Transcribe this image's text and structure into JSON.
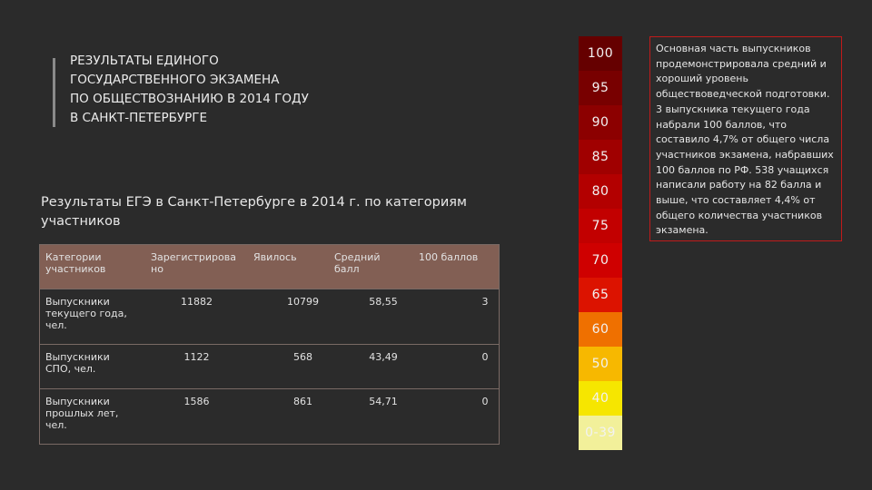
{
  "slide": {
    "title_lines": [
      "РЕЗУЛЬТАТЫ ЕДИНОГО",
      "ГОСУДАРСТВЕННОГО ЭКЗАМЕНА",
      "ПО ОБЩЕСТВОЗНАНИЮ В 2014 ГОДУ",
      "В САНКТ-ПЕТЕРБУРГЕ"
    ],
    "subtitle": "Результаты ЕГЭ в Санкт-Петербурге в 2014 г. по категориям участников"
  },
  "table": {
    "headers": [
      "Категории участников",
      "Зарегистрирова но",
      "Явилось",
      "Средний балл",
      "100 баллов"
    ],
    "rows": [
      {
        "category": "Выпускники текущего года, чел.",
        "registered": "11882",
        "appeared": "10799",
        "average": "58,55",
        "hundred": "3"
      },
      {
        "category": "Выпускники СПО, чел.",
        "registered": "1122",
        "appeared": "568",
        "average": "43,49",
        "hundred": "0"
      },
      {
        "category": "Выпускники прошлых лет, чел.",
        "registered": "1586",
        "appeared": "861",
        "average": "54,71",
        "hundred": "0"
      }
    ]
  },
  "scale": {
    "items": [
      {
        "label": "100",
        "color": "#650000"
      },
      {
        "label": "95",
        "color": "#780000"
      },
      {
        "label": "90",
        "color": "#8c0000"
      },
      {
        "label": "85",
        "color": "#a00000"
      },
      {
        "label": "80",
        "color": "#b30000"
      },
      {
        "label": "75",
        "color": "#c20000"
      },
      {
        "label": "70",
        "color": "#cf0000"
      },
      {
        "label": "65",
        "color": "#dc1300"
      },
      {
        "label": "60",
        "color": "#ef7000"
      },
      {
        "label": "50",
        "color": "#f7b800"
      },
      {
        "label": "40",
        "color": "#f6e600"
      },
      {
        "label": "0-39",
        "color": "#f2f09a"
      }
    ]
  },
  "info": {
    "text": "Основная часть выпускников продемонстрировала средний и хороший уровень обществоведческой подготовки. 3 выпускника текущего года набрали 100 баллов, что составило 4,7% от общего числа участников экзамена, набравших 100 баллов по РФ. 538 учащихся написали работу на 82 балла и выше, что составляет 4,4% от общего количества участников экзамена."
  }
}
